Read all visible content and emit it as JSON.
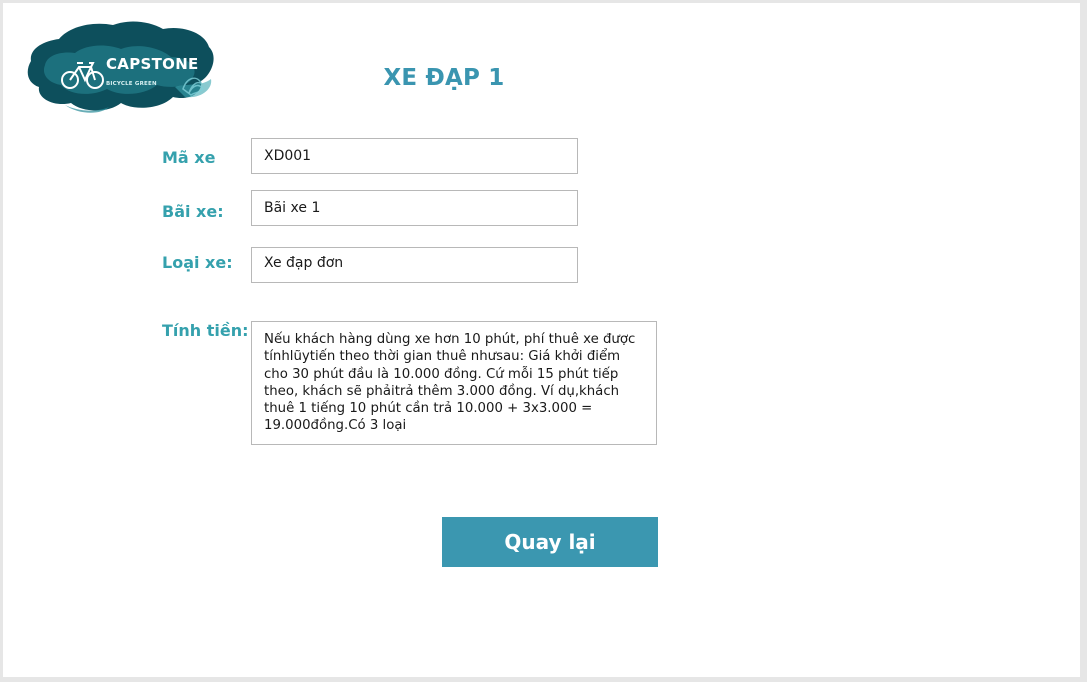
{
  "logo": {
    "brand": "CAPSTONE",
    "tagline": "BICYCLE GREEN"
  },
  "page": {
    "title": "XE ĐẠP 1"
  },
  "form": {
    "ma_xe_label": "Mã xe",
    "ma_xe_value": "XD001",
    "bai_xe_label": "Bãi xe:",
    "bai_xe_value": "Bãi xe 1",
    "loai_xe_label": "Loại xe:",
    "loai_xe_value": "Xe đạp đơn",
    "tinh_tien_label": "Tính tiền:",
    "tinh_tien_value": "Nếu khách hàng dùng xe hơn 10 phút, phí thuê xe được tínhlũytiến theo thời gian thuê nhưsau: Giá khởi điểm cho 30 phút đầu là 10.000 đồng. Cứ mỗi 15 phút tiếp theo, khách sẽ phảitrả thêm 3.000 đồng. Ví dụ,khách thuê 1 tiếng 10 phút cần trả 10.000 + 3x3.000 = 19.000đồng.Có 3 loại"
  },
  "actions": {
    "back_label": "Quay lại"
  },
  "colors": {
    "accent": "#3b97b0",
    "label": "#35a1ad",
    "logo_dark": "#0d4f5c",
    "logo_mid": "#2a8c99"
  },
  "icons": {
    "logo_icon": "bicycle-icon"
  }
}
